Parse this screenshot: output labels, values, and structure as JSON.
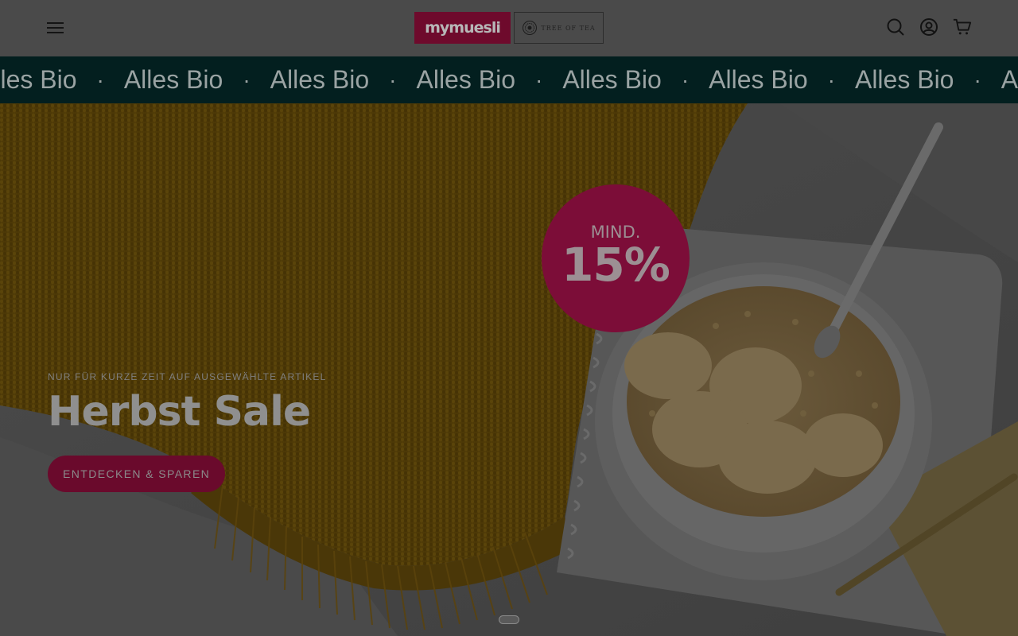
{
  "header": {
    "menu_icon": "hamburger-menu-icon",
    "logo_mymuesli": "mymuesli",
    "logo_treeoftea": "TREE OF TEA",
    "icons": [
      "search-icon",
      "account-icon",
      "cart-icon"
    ]
  },
  "marquee": {
    "items": [
      "Alles Bio",
      "Alles Bio",
      "Alles Bio",
      "Alles Bio",
      "Alles Bio",
      "Alles Bio",
      "Alles Bio",
      "Alles Bio"
    ],
    "separator": "·"
  },
  "hero": {
    "eyebrow": "NUR FÜR KURZE ZEIT AUF AUSGEWÄHLTE ARTIKEL",
    "title": "Herbst Sale",
    "cta_label": "ENTDECKEN & SPAREN",
    "badge": {
      "small": "MIND.",
      "big": "15%"
    }
  },
  "colors": {
    "header_bg": "#4a4a4a",
    "marquee_bg": "#031f1f",
    "brand": "#6e0a2c",
    "badge": "#7c0d38"
  }
}
